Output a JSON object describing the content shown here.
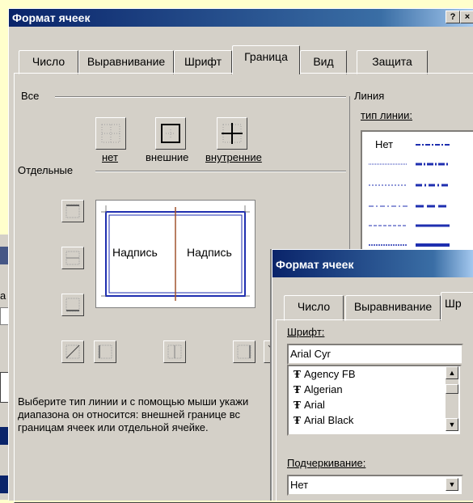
{
  "main_dialog": {
    "title": "Формат ячеек",
    "help_btn": "?",
    "close_btn": "×",
    "tabs": [
      {
        "label": "Число"
      },
      {
        "label": "Выравнивание"
      },
      {
        "label": "Шрифт"
      },
      {
        "label": "Граница"
      },
      {
        "label": "Вид"
      },
      {
        "label": "Защита"
      }
    ],
    "active_tab": "Граница",
    "all_group": "Все",
    "presets": {
      "none": "нет",
      "outer": "внешние",
      "inner": "внутренние"
    },
    "separate_group": "Отдельные",
    "preview": {
      "cell_left": "Надпись",
      "cell_right": "Надпись"
    },
    "line_group": "Линия",
    "line_type_label": "тип линии:",
    "line_none": "Нет",
    "hint": [
      "Выберите тип линии и с помощью мыши укажи",
      "диапазона он относится: внешней границе вс",
      "границам ячеек или отдельной ячейке."
    ]
  },
  "second_dialog": {
    "title": "Формат ячеек",
    "tabs": [
      {
        "label": "Число"
      },
      {
        "label": "Выравнивание"
      },
      {
        "label": "Шр"
      }
    ],
    "font_label": "Шрифт:",
    "font_value": "Arial Cyr",
    "fonts": [
      {
        "name": "Agency FB"
      },
      {
        "name": "Algerian"
      },
      {
        "name": "Arial"
      },
      {
        "name": "Arial Black"
      }
    ],
    "underline_label": "Подчеркивание:",
    "underline_value": "Нет"
  },
  "background": {
    "partial_text": "а"
  },
  "colors": {
    "title_blue": "#0a246a",
    "face": "#d4d0c8",
    "slide": "#ffffcc",
    "line_blue": "#1f2fb0"
  }
}
